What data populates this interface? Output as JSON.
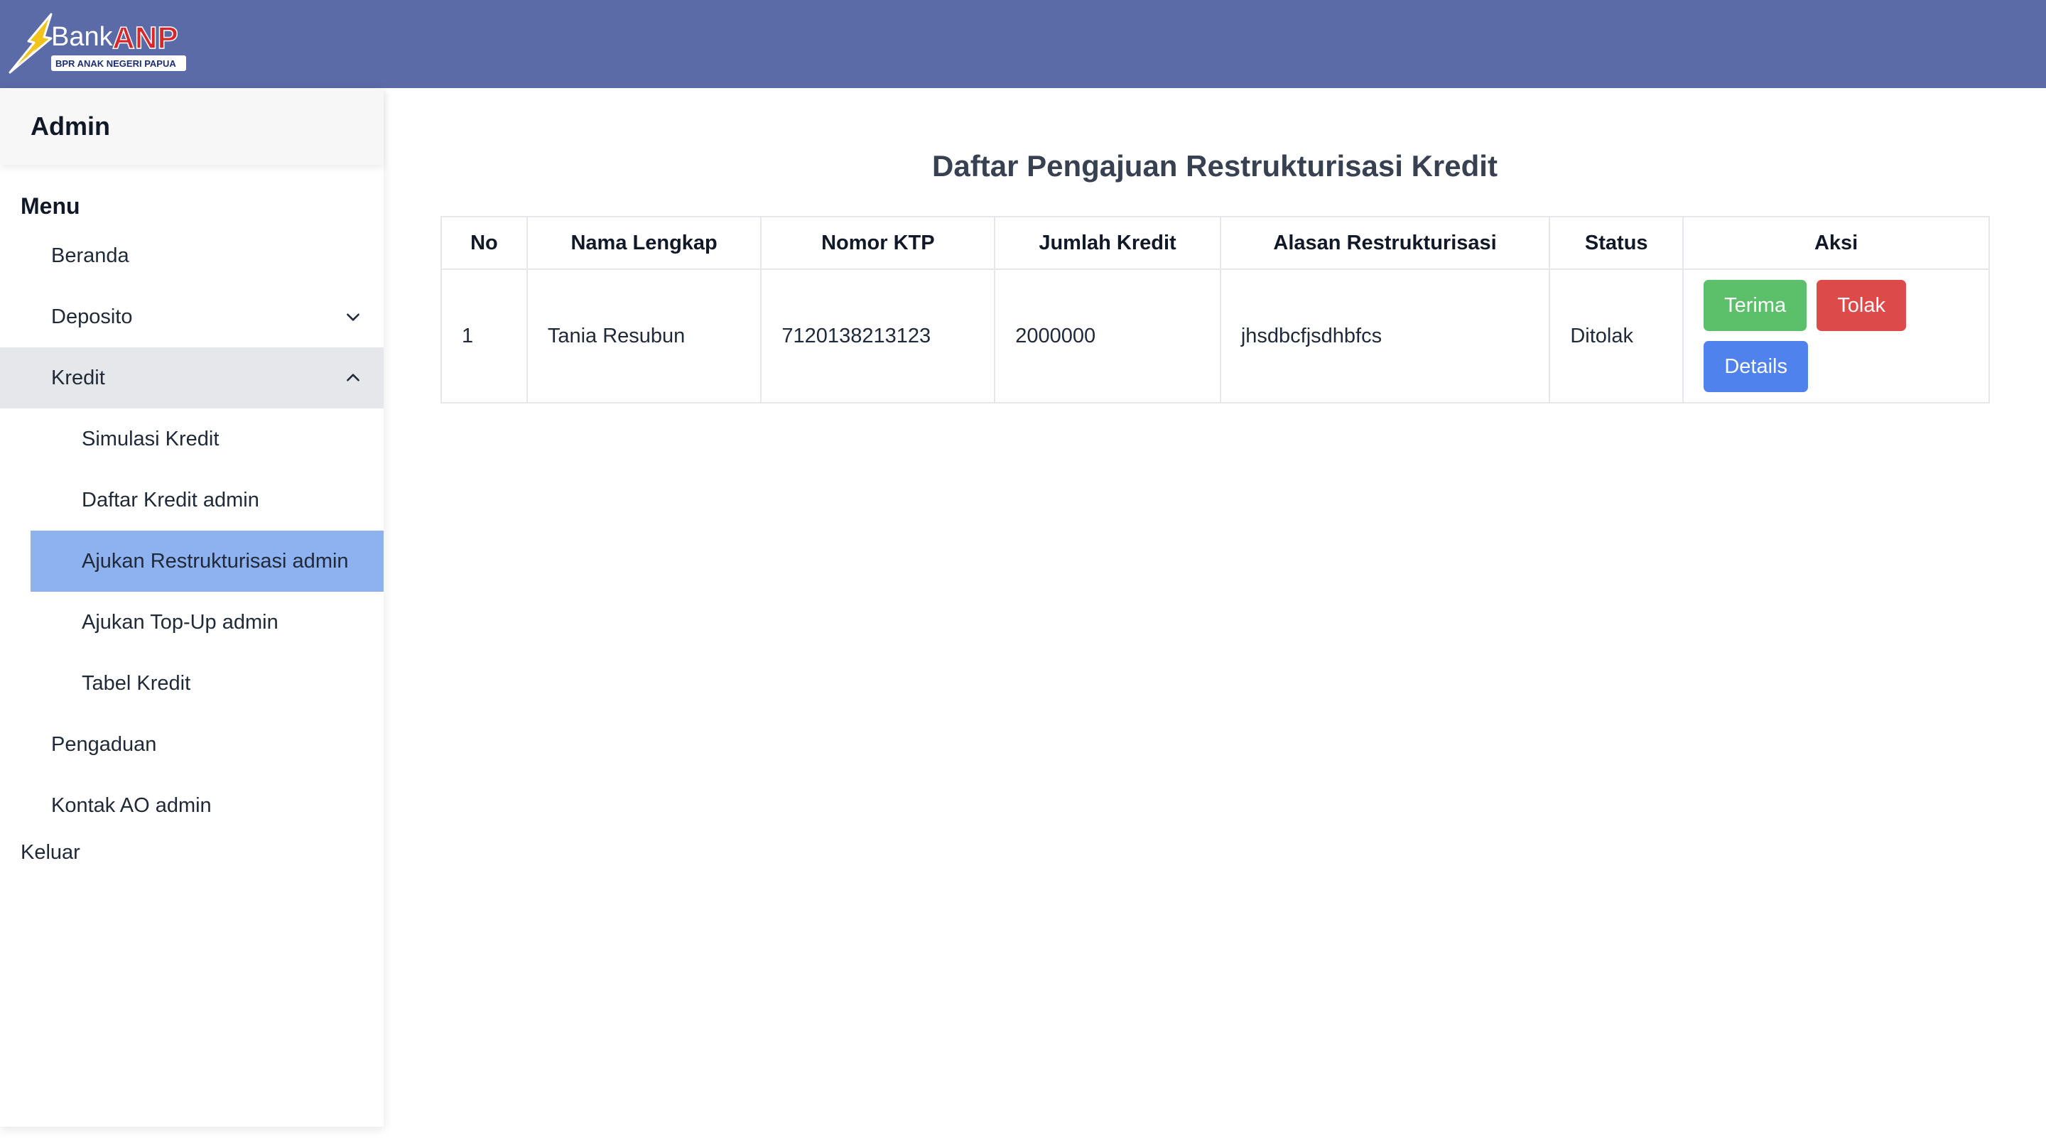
{
  "brand": {
    "name": "Bank",
    "name_accent": "ANP",
    "tagline": "BPR ANAK NEGERI PAPUA"
  },
  "sidebar": {
    "header": "Admin",
    "menu_title": "Menu",
    "items": {
      "beranda": "Beranda",
      "deposito": "Deposito",
      "kredit": "Kredit",
      "pengaduan": "Pengaduan",
      "kontak": "Kontak AO admin"
    },
    "kredit_submenu": {
      "simulasi": "Simulasi Kredit",
      "daftar": "Daftar Kredit admin",
      "restrukturisasi": "Ajukan Restrukturisasi admin",
      "topup": "Ajukan Top-Up admin",
      "tabel": "Tabel Kredit"
    },
    "logout": "Keluar"
  },
  "main": {
    "title": "Daftar Pengajuan Restrukturisasi Kredit",
    "columns": {
      "no": "No",
      "nama": "Nama Lengkap",
      "ktp": "Nomor KTP",
      "jumlah": "Jumlah Kredit",
      "alasan": "Alasan Restrukturisasi",
      "status": "Status",
      "aksi": "Aksi"
    },
    "rows": [
      {
        "no": "1",
        "nama": "Tania Resubun",
        "ktp": "7120138213123",
        "jumlah": "2000000",
        "alasan": "jhsdbcfjsdhbfcs",
        "status": "Ditolak"
      }
    ],
    "actions": {
      "accept": "Terima",
      "reject": "Tolak",
      "details": "Details"
    }
  },
  "colors": {
    "topbar": "#5b6ba8",
    "active_item": "#8eb1f0",
    "accept": "#5cbf69",
    "reject": "#dc4a4a",
    "details": "#4f82ec"
  },
  "icons": {
    "deposito_toggle": "chevron-down-icon",
    "kredit_toggle": "chevron-up-icon"
  }
}
